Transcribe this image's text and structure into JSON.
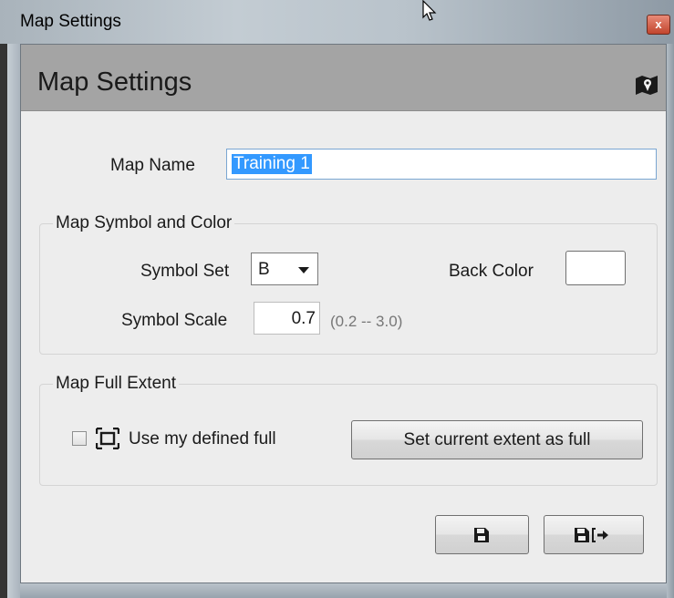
{
  "window": {
    "title": "Map Settings",
    "close_label": "x"
  },
  "header": {
    "title": "Map Settings",
    "icon": "map-icon"
  },
  "map_name": {
    "label": "Map Name",
    "value": "Training 1"
  },
  "symbol_group": {
    "title": "Map Symbol and Color",
    "symbol_set_label": "Symbol Set",
    "symbol_set_value": "B",
    "back_color_label": "Back Color",
    "back_color_value": "#ffffff",
    "symbol_scale_label": "Symbol Scale",
    "symbol_scale_value": "0.7",
    "symbol_scale_range": "(0.2 -- 3.0)"
  },
  "extent_group": {
    "title": "Map Full Extent",
    "use_defined_label": "Use my defined full",
    "use_defined_checked": false,
    "set_current_label": "Set current extent as full"
  },
  "footer": {
    "save_icon": "save-icon",
    "save_close_icon": "save-and-close-icon"
  },
  "colors": {
    "header_band": "#a4a4a4",
    "client_bg": "#ededed",
    "selection": "#3399ff"
  }
}
